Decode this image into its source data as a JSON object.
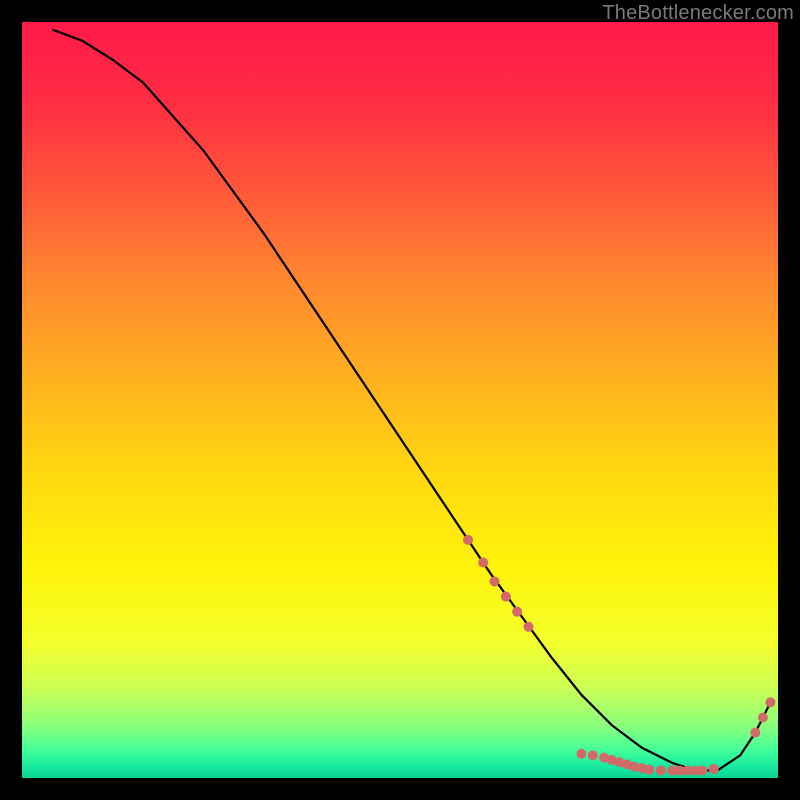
{
  "attribution": "TheBottlenecker.com",
  "gradient_stops": [
    {
      "offset": 0.0,
      "color": "#ff1a49"
    },
    {
      "offset": 0.1,
      "color": "#ff2b44"
    },
    {
      "offset": 0.22,
      "color": "#ff563a"
    },
    {
      "offset": 0.35,
      "color": "#ff8a2e"
    },
    {
      "offset": 0.48,
      "color": "#ffb31e"
    },
    {
      "offset": 0.6,
      "color": "#ffd90f"
    },
    {
      "offset": 0.72,
      "color": "#fff30a"
    },
    {
      "offset": 0.82,
      "color": "#f4ff2a"
    },
    {
      "offset": 0.88,
      "color": "#ccff55"
    },
    {
      "offset": 0.93,
      "color": "#8cff7a"
    },
    {
      "offset": 0.965,
      "color": "#3fff9b"
    },
    {
      "offset": 0.985,
      "color": "#18e9a0"
    },
    {
      "offset": 1.0,
      "color": "#0bd297"
    }
  ],
  "chart_data": {
    "type": "line",
    "title": "",
    "xlabel": "",
    "ylabel": "",
    "xlim": [
      0,
      100
    ],
    "ylim": [
      0,
      100
    ],
    "series": [
      {
        "name": "curve",
        "x": [
          4,
          8,
          12,
          16,
          24,
          32,
          40,
          48,
          56,
          62,
          66,
          70,
          74,
          78,
          82,
          86,
          89,
          92,
          95,
          97,
          99
        ],
        "y": [
          99,
          97.5,
          95,
          92,
          83,
          72,
          60,
          48,
          36,
          27,
          21.5,
          16,
          11,
          7,
          4,
          2,
          1,
          1,
          3,
          6,
          10
        ]
      }
    ],
    "markers": [
      {
        "x": 59,
        "y": 31.5
      },
      {
        "x": 61,
        "y": 28.5
      },
      {
        "x": 62.5,
        "y": 26
      },
      {
        "x": 64,
        "y": 24
      },
      {
        "x": 65.5,
        "y": 22
      },
      {
        "x": 67,
        "y": 20
      },
      {
        "x": 74,
        "y": 3.2
      },
      {
        "x": 75.5,
        "y": 3
      },
      {
        "x": 77,
        "y": 2.7
      },
      {
        "x": 78,
        "y": 2.4
      },
      {
        "x": 79,
        "y": 2.1
      },
      {
        "x": 80,
        "y": 1.8
      },
      {
        "x": 81,
        "y": 1.5
      },
      {
        "x": 82,
        "y": 1.3
      },
      {
        "x": 83,
        "y": 1.1
      },
      {
        "x": 84.5,
        "y": 1.0
      },
      {
        "x": 86,
        "y": 1.0
      },
      {
        "x": 87,
        "y": 1.0
      },
      {
        "x": 88,
        "y": 1.0
      },
      {
        "x": 89,
        "y": 1.0
      },
      {
        "x": 90,
        "y": 1.0
      },
      {
        "x": 91.5,
        "y": 1.2
      },
      {
        "x": 97,
        "y": 6
      },
      {
        "x": 98,
        "y": 8
      },
      {
        "x": 99,
        "y": 10
      }
    ],
    "marker_color": "#d16a68",
    "marker_radius": 5,
    "line_color": "#000000",
    "line_width": 2.2
  }
}
